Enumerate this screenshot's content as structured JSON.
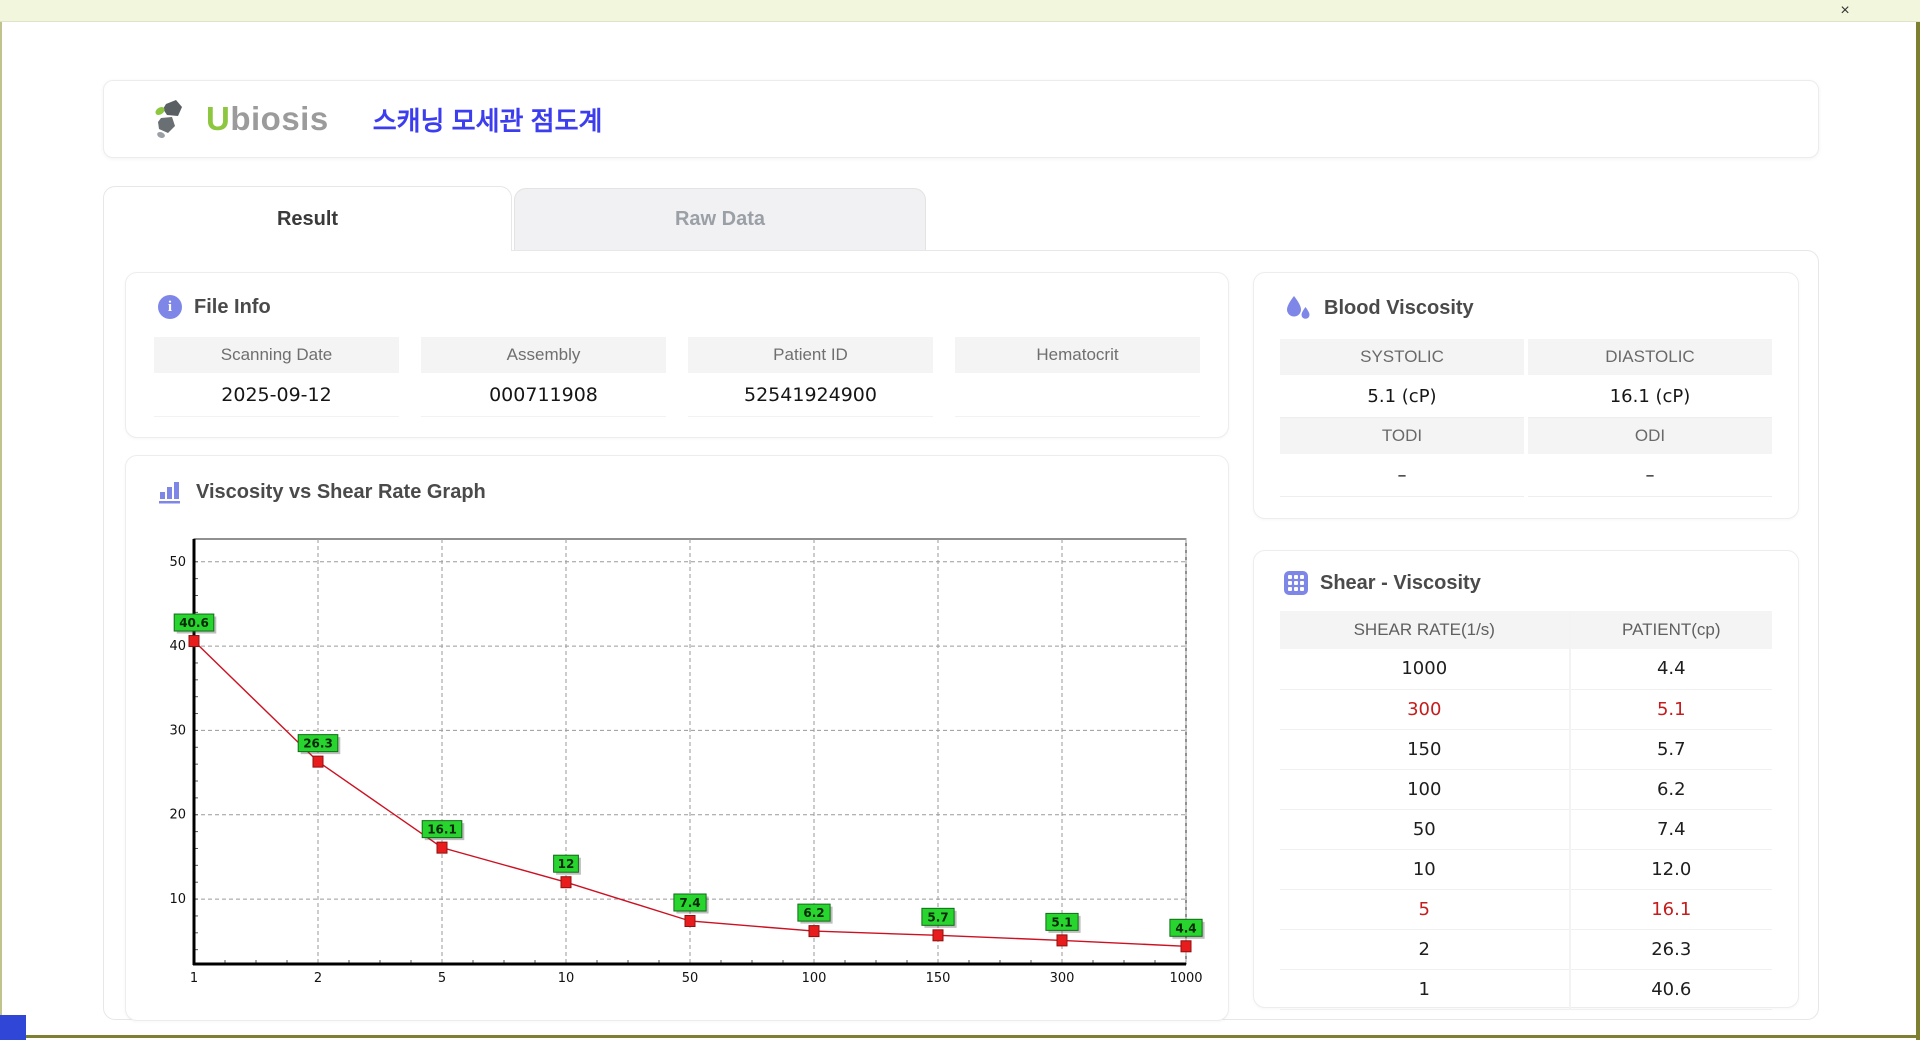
{
  "window": {
    "close_label": "×"
  },
  "header": {
    "brand_u": "U",
    "brand_rest": "biosis",
    "subtitle": "스캐닝 모세관 점도계"
  },
  "tabs": [
    {
      "label": "Result",
      "active": true
    },
    {
      "label": "Raw Data",
      "active": false
    }
  ],
  "file_info": {
    "title": "File Info",
    "fields": [
      {
        "label": "Scanning Date",
        "value": "2025-09-12"
      },
      {
        "label": "Assembly",
        "value": "000711908"
      },
      {
        "label": "Patient ID",
        "value": "52541924900"
      },
      {
        "label": "Hematocrit",
        "value": ""
      }
    ]
  },
  "blood_viscosity": {
    "title": "Blood Viscosity",
    "rows": [
      {
        "labels": [
          "SYSTOLIC",
          "DIASTOLIC"
        ],
        "values": [
          "5.1 (cP)",
          "16.1 (cP)"
        ]
      },
      {
        "labels": [
          "TODI",
          "ODI"
        ],
        "values": [
          "–",
          "–"
        ]
      }
    ]
  },
  "shear_viscosity": {
    "title": "Shear - Viscosity",
    "columns": [
      "SHEAR RATE(1/s)",
      "PATIENT(cp)"
    ],
    "highlight_color": "#c41d1d",
    "rows": [
      {
        "shear_rate": "1000",
        "patient": "4.4",
        "highlight": false
      },
      {
        "shear_rate": "300",
        "patient": "5.1",
        "highlight": true
      },
      {
        "shear_rate": "150",
        "patient": "5.7",
        "highlight": false
      },
      {
        "shear_rate": "100",
        "patient": "6.2",
        "highlight": false
      },
      {
        "shear_rate": "50",
        "patient": "7.4",
        "highlight": false
      },
      {
        "shear_rate": "10",
        "patient": "12.0",
        "highlight": false
      },
      {
        "shear_rate": "5",
        "patient": "16.1",
        "highlight": true
      },
      {
        "shear_rate": "2",
        "patient": "26.3",
        "highlight": false
      },
      {
        "shear_rate": "1",
        "patient": "40.6",
        "highlight": false
      }
    ]
  },
  "graph": {
    "title": "Viscosity vs Shear Rate Graph"
  },
  "chart_data": {
    "type": "line",
    "title": "Viscosity vs Shear Rate Graph",
    "xlabel": "",
    "ylabel": "",
    "x_scale": "categorical",
    "x_categories": [
      "1",
      "2",
      "5",
      "10",
      "50",
      "100",
      "150",
      "300",
      "1000"
    ],
    "series": [
      {
        "name": "patient-viscosity-cp",
        "values": [
          40.6,
          26.3,
          16.1,
          12,
          7.4,
          6.2,
          5.7,
          5.1,
          4.4
        ],
        "point_labels": [
          "40.6",
          "26.3",
          "16.1",
          "12",
          "7.4",
          "6.2",
          "5.7",
          "5.1",
          "4.4"
        ],
        "color": "#cc1122"
      }
    ],
    "y_ticks": [
      10,
      20,
      30,
      40,
      50
    ],
    "y_min": 2.3,
    "y_max": 52.7,
    "grid": "dashed",
    "legend": "none",
    "marker": "square",
    "marker_color": "#e81c1c",
    "point_label_bg": "#28d42e"
  },
  "colors": {
    "accent_purple": "#7e87e8",
    "brand_green": "#8dc63f",
    "subtitle_blue": "#3d3df0",
    "frame_olive": "#7d8030",
    "highlight_red": "#c41d1d"
  }
}
